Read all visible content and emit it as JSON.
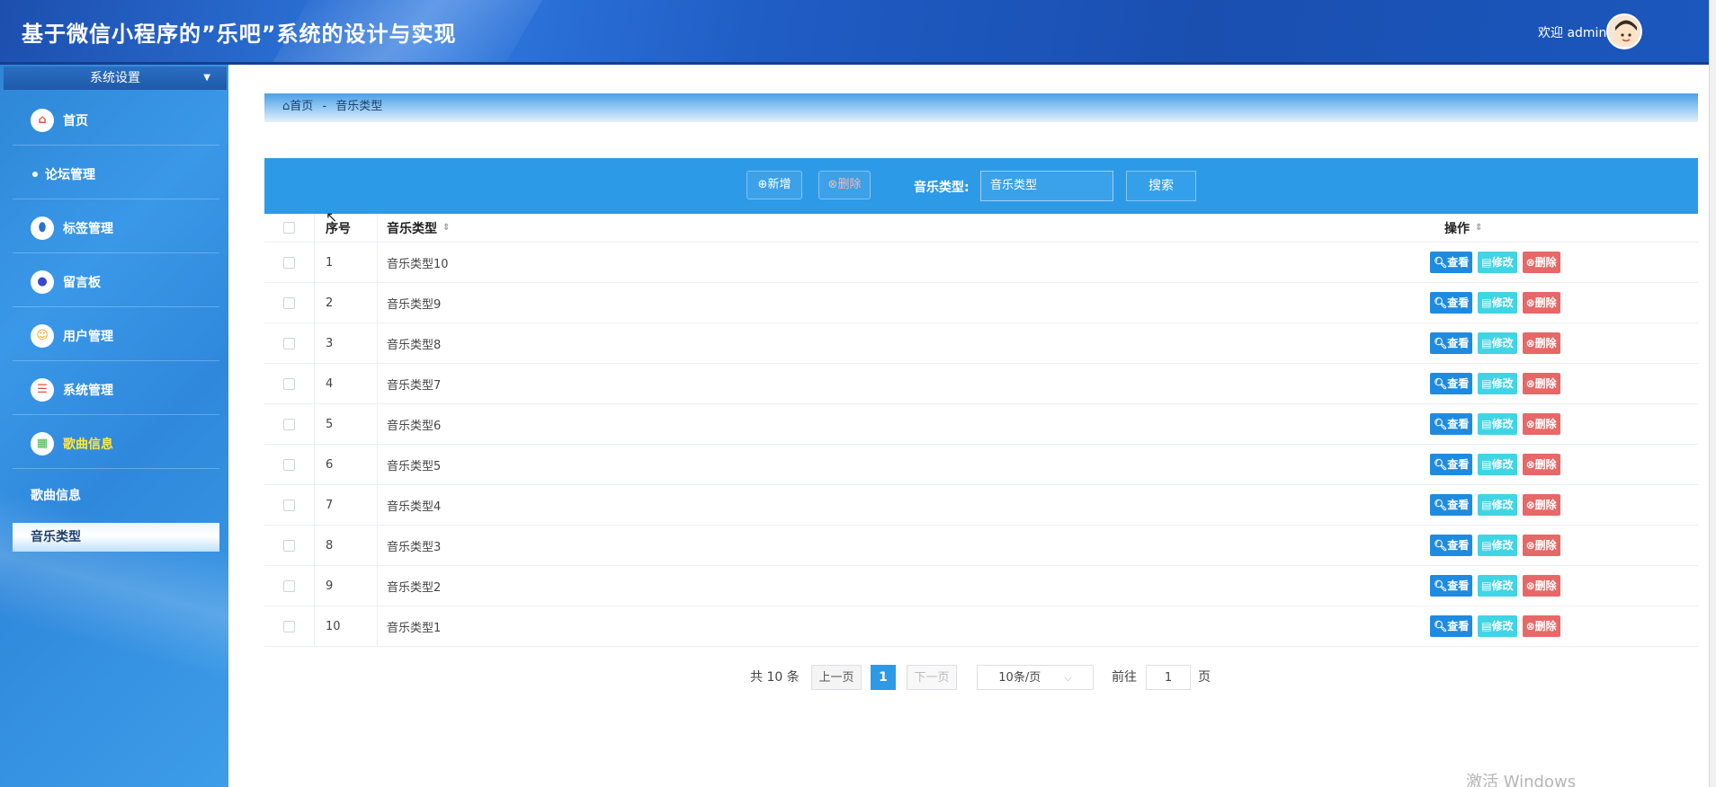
{
  "header": {
    "title": "基于微信小程序的”乐吧”系统的设计与实现",
    "welcome": "欢迎 admin"
  },
  "sidebar": {
    "head": "系统设置",
    "items": [
      {
        "label": "首页",
        "icon": "home-icon",
        "color": "#e8563f",
        "glyph": "⌂"
      },
      {
        "label": "论坛管理",
        "icon": "dot-icon"
      },
      {
        "label": "标签管理",
        "icon": "tag-icon",
        "color": "#2b6fd1",
        "glyph": "⬮"
      },
      {
        "label": "留言板",
        "icon": "message-icon",
        "color": "#3a48c9",
        "glyph": "●"
      },
      {
        "label": "用户管理",
        "icon": "user-icon",
        "color": "#f1a21b",
        "glyph": "☺"
      },
      {
        "label": "系统管理",
        "icon": "server-icon",
        "color": "#e2503a",
        "glyph": "☰"
      },
      {
        "label": "歌曲信息",
        "icon": "music-icon",
        "color": "#3ab54a",
        "glyph": "▦"
      }
    ],
    "subitems": [
      {
        "label": "歌曲信息"
      },
      {
        "label": "音乐类型"
      }
    ]
  },
  "breadcrumb": {
    "home": "首页",
    "sep": "-",
    "current": "音乐类型"
  },
  "toolbar": {
    "add": "新增",
    "delete": "删除",
    "filter_label": "音乐类型:",
    "filter_value": "音乐类型",
    "search": "搜索"
  },
  "table": {
    "headers": {
      "index": "序号",
      "name": "音乐类型",
      "ops": "操作"
    },
    "rows": [
      {
        "index": "1",
        "name": "音乐类型10"
      },
      {
        "index": "2",
        "name": "音乐类型9"
      },
      {
        "index": "3",
        "name": "音乐类型8"
      },
      {
        "index": "4",
        "name": "音乐类型7"
      },
      {
        "index": "5",
        "name": "音乐类型6"
      },
      {
        "index": "6",
        "name": "音乐类型5"
      },
      {
        "index": "7",
        "name": "音乐类型4"
      },
      {
        "index": "8",
        "name": "音乐类型3"
      },
      {
        "index": "9",
        "name": "音乐类型2"
      },
      {
        "index": "10",
        "name": "音乐类型1"
      }
    ],
    "ops": {
      "view": "查看",
      "edit": "修改",
      "del": "删除"
    }
  },
  "pager": {
    "total": "共 10 条",
    "prev": "上一页",
    "current": "1",
    "next": "下一页",
    "size": "10条/页",
    "goto": "前往",
    "goto_value": "1",
    "page_unit": "页"
  },
  "watermark": "激活 Windows",
  "colors": {
    "accent": "#2d9ae7",
    "view": "#1f8be0",
    "edit": "#40d5e4",
    "danger": "#e86767"
  }
}
